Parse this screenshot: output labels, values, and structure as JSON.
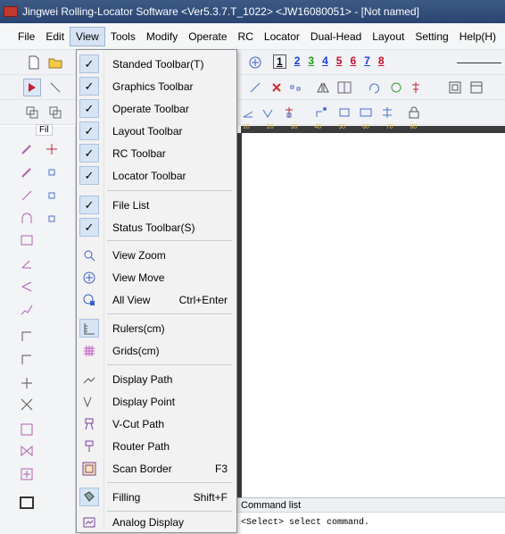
{
  "window": {
    "title": "Jingwei Rolling-Locator Software <Ver5.3.7.T_1022> <JW16080051> - [Not named]"
  },
  "menubar": {
    "items": [
      "File",
      "Edit",
      "View",
      "Tools",
      "Modify",
      "Operate",
      "RC",
      "Locator",
      "Dual-Head",
      "Layout",
      "Setting",
      "Help(H)"
    ]
  },
  "toolbar": {
    "layer_numbers": [
      "1",
      "2",
      "3",
      "4",
      "5",
      "6",
      "7",
      "8"
    ],
    "layer_colors": [
      "#000000",
      "#1a3fd1",
      "#1a9d1a",
      "#1a3fd1",
      "#c8102e",
      "#c8102e",
      "#1a3fd1",
      "#c8102e"
    ],
    "file_list_tab": "Fil"
  },
  "view_menu": {
    "items": [
      {
        "label": "Standed Toolbar(T)",
        "checked": true
      },
      {
        "label": "Graphics Toolbar",
        "checked": true
      },
      {
        "label": "Operate Toolbar",
        "checked": true
      },
      {
        "label": "Layout Toolbar",
        "checked": true
      },
      {
        "label": "RC Toolbar",
        "checked": true
      },
      {
        "label": "Locator Toolbar",
        "checked": true
      },
      {
        "label": "File List",
        "checked": true
      },
      {
        "label": "Status Toolbar(S)",
        "checked": true
      },
      {
        "label": "View Zoom",
        "icon": "zoom-icon"
      },
      {
        "label": "View Move",
        "icon": "move-icon"
      },
      {
        "label": "All View",
        "icon": "all-view-icon",
        "shortcut": "Ctrl+Enter"
      },
      {
        "label": "Rulers(cm)",
        "icon": "ruler-icon"
      },
      {
        "label": "Grids(cm)",
        "icon": "grid-icon"
      },
      {
        "label": "Display Path",
        "icon": "path-icon"
      },
      {
        "label": "Display Point",
        "icon": "point-icon"
      },
      {
        "label": "V-Cut Path",
        "icon": "vcut-icon"
      },
      {
        "label": "Router Path",
        "icon": "router-icon"
      },
      {
        "label": "Scan Border",
        "icon": "scan-border-icon",
        "shortcut": "F3"
      },
      {
        "label": "Filling",
        "icon": "filling-icon",
        "shortcut": "Shift+F"
      },
      {
        "label": "Analog Display",
        "icon": "analog-display-icon"
      }
    ]
  },
  "ruler": {
    "ticks": [
      "10",
      "20",
      "30",
      "40",
      "50",
      "60",
      "70",
      "80"
    ]
  },
  "command_panel": {
    "title": "Command list",
    "line": "<Select> select command."
  }
}
